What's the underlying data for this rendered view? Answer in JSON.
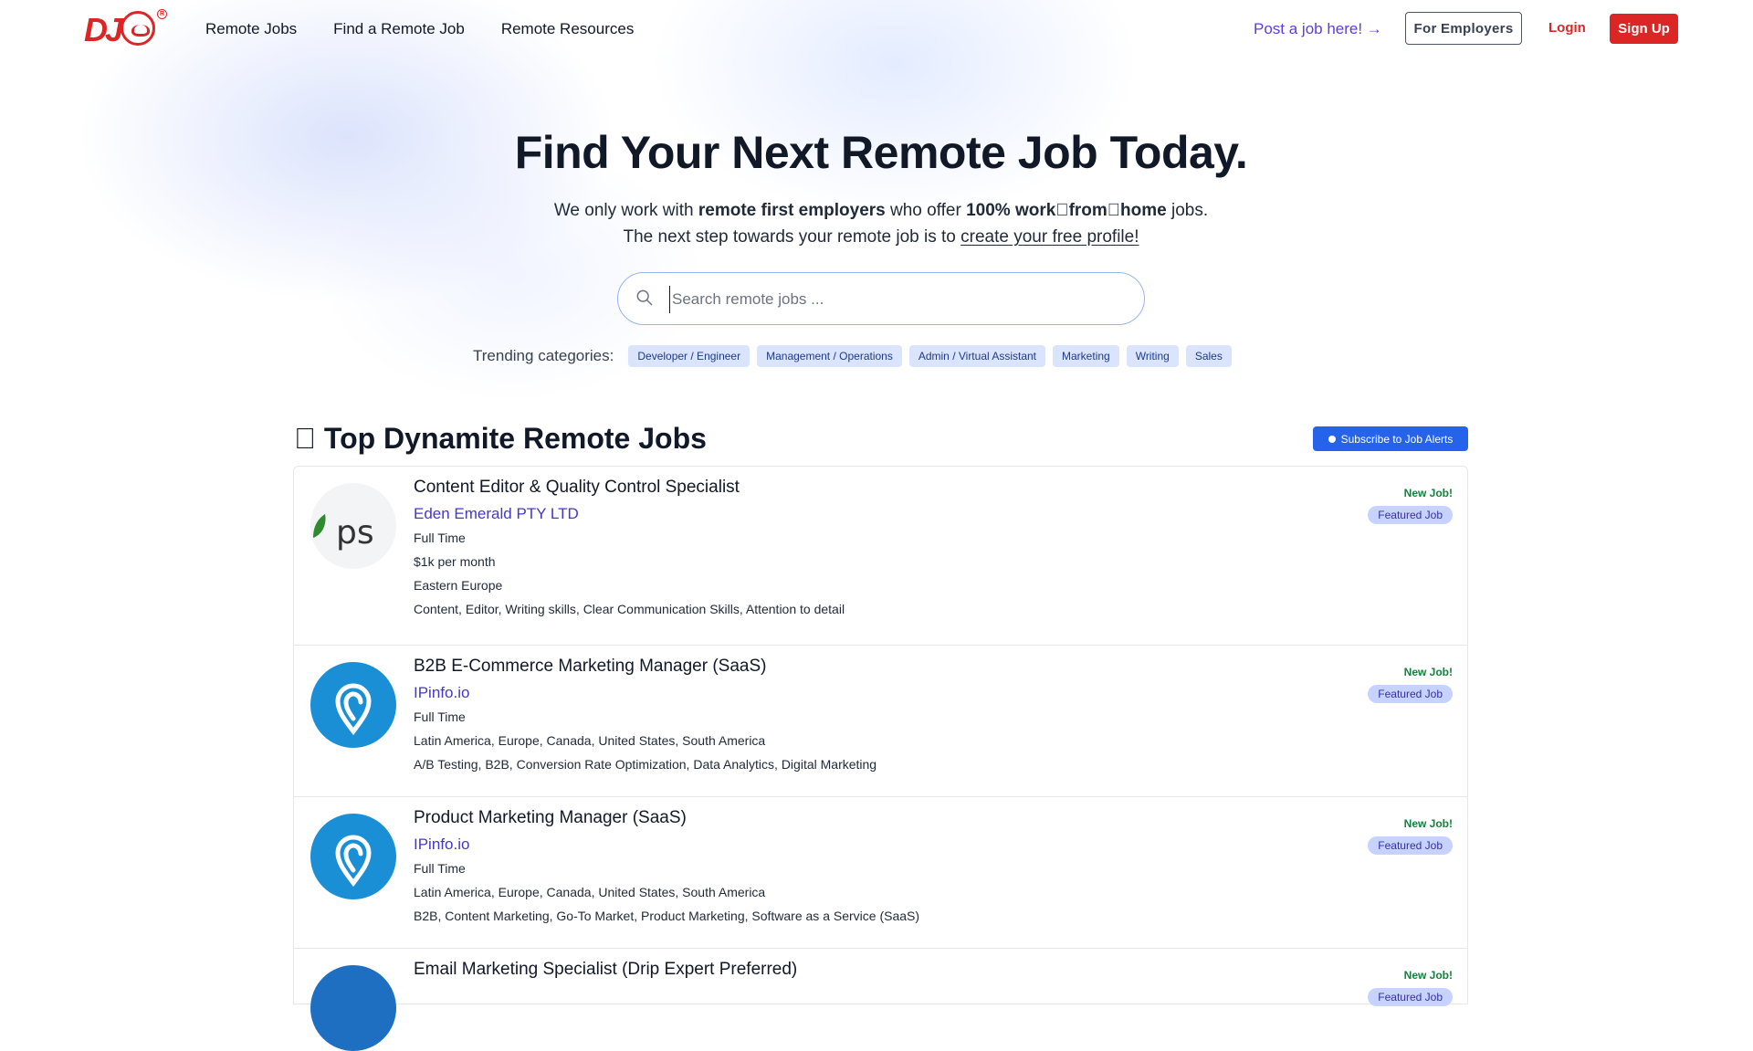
{
  "header": {
    "logo_text": "DJ",
    "nav": [
      "Remote Jobs",
      "Find a Remote Job",
      "Remote Resources"
    ],
    "post_link": "Post a job here! →",
    "for_employers": "For Employers",
    "login": "Login",
    "signup": "Sign Up"
  },
  "hero": {
    "title": "Find Your Next Remote Job Today.",
    "line1_a": "We only work with ",
    "line1_b": "remote first employers",
    "line1_c": " who offer ",
    "line1_d": "100% work\u0000from\u0000home",
    "line1_e": " jobs.",
    "line2_a": "The next step towards your remote job is to ",
    "line2_link": "create your free profile!",
    "search_placeholder": "Search remote jobs ...",
    "trending_label": "Trending categories:",
    "categories": [
      "Developer / Engineer",
      "Management / Operations",
      "Admin / Virtual Assistant",
      "Marketing",
      "Writing",
      "Sales"
    ]
  },
  "section": {
    "title": "\u0000 Top Dynamite Remote Jobs",
    "subscribe": "Subscribe to Job Alerts"
  },
  "jobs": [
    {
      "title": "Content Editor & Quality Control Specialist",
      "company": "Eden Emerald PTY LTD",
      "lines": [
        "Full Time",
        "$1k per month",
        "Eastern Europe",
        "Content, Editor, Writing skills, Clear Communication Skills, Attention to detail"
      ],
      "new": "New Job!",
      "featured": "Featured Job",
      "logo": "pse"
    },
    {
      "title": "B2B E-Commerce Marketing Manager (SaaS)",
      "company": "IPinfo.io",
      "lines": [
        "Full Time",
        "Latin America, Europe, Canada, United States, South America",
        "A/B Testing, B2B, Conversion Rate Optimization, Data Analytics, Digital Marketing"
      ],
      "new": "New Job!",
      "featured": "Featured Job",
      "logo": "ipinfo"
    },
    {
      "title": "Product Marketing Manager (SaaS)",
      "company": "IPinfo.io",
      "lines": [
        "Full Time",
        "Latin America, Europe, Canada, United States, South America",
        "B2B, Content Marketing, Go-To Market, Product Marketing, Software as a Service (SaaS)"
      ],
      "new": "New Job!",
      "featured": "Featured Job",
      "logo": "ipinfo"
    },
    {
      "title": "Email Marketing Specialist (Drip Expert Preferred)",
      "company": "",
      "lines": [],
      "new": "New Job!",
      "featured": "Featured Job",
      "logo": "ipinfo"
    }
  ],
  "colors": {
    "brand_red": "#dc2626",
    "link_purple": "#5b3fd6",
    "company_indigo": "#4338ca",
    "chip_bg": "#dbe4fd",
    "new_green": "#15803d"
  }
}
